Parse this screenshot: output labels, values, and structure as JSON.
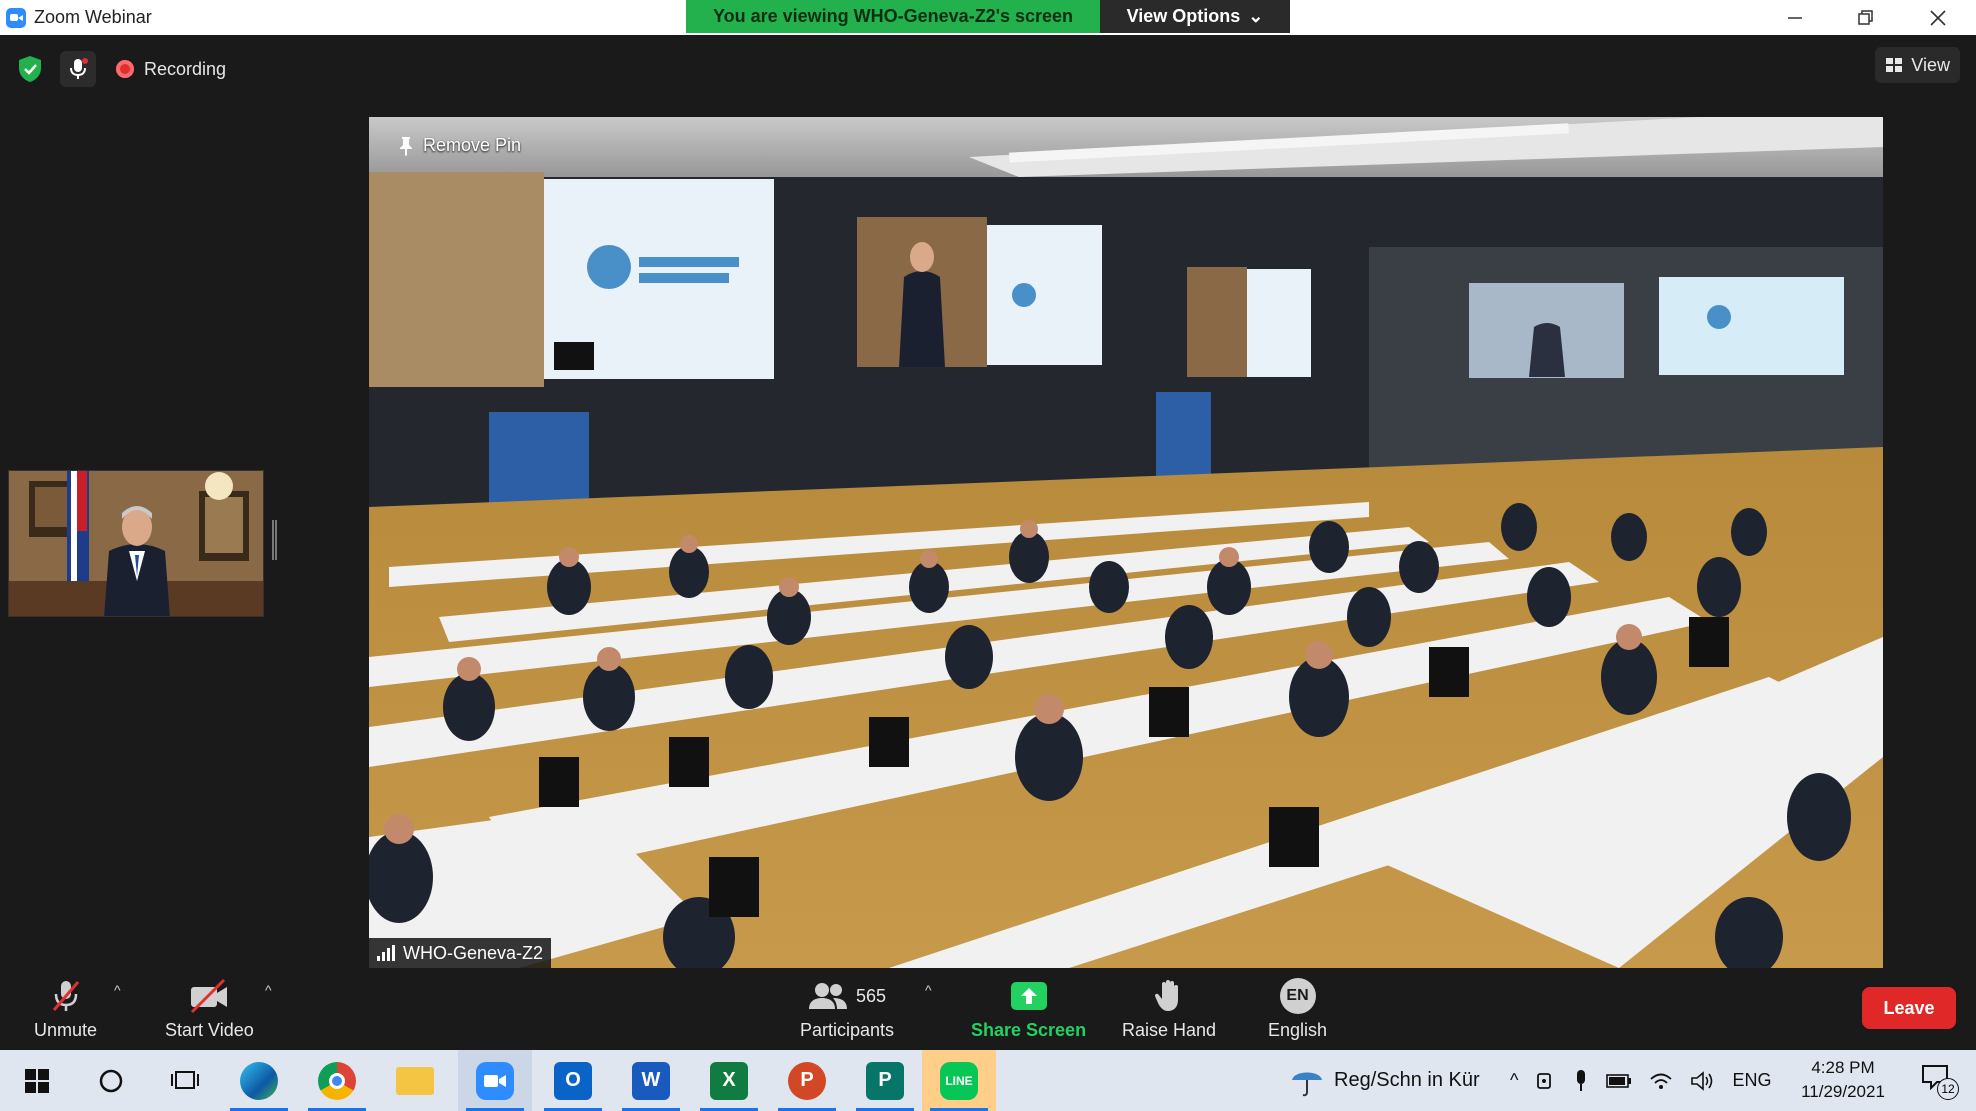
{
  "window": {
    "title": "Zoom Webinar",
    "viewing_banner": "You are viewing WHO-Geneva-Z2's screen",
    "view_options": "View Options"
  },
  "meeting": {
    "recording_label": "Recording",
    "view_label": "View",
    "remove_pin": "Remove Pin",
    "active_speaker": "WHO-Geneva-Z2"
  },
  "controls": {
    "unmute": "Unmute",
    "start_video": "Start Video",
    "participants_label": "Participants",
    "participants_count": "565",
    "share_screen": "Share Screen",
    "raise_hand": "Raise Hand",
    "language_code": "EN",
    "language": "English",
    "leave": "Leave"
  },
  "taskbar": {
    "apps": [
      "start",
      "search",
      "task-view",
      "edge",
      "chrome",
      "file-explorer",
      "zoom",
      "outlook",
      "word",
      "excel",
      "powerpoint",
      "publisher",
      "line"
    ],
    "weather_text": "Reg/Schn in Kür",
    "input_language": "ENG",
    "time": "4:28 PM",
    "date": "11/29/2021",
    "notifications": "12"
  },
  "colors": {
    "banner_green": "#22b14c",
    "leave_red": "#e02828",
    "share_green": "#22d160",
    "recording_red": "#e02f2f"
  }
}
